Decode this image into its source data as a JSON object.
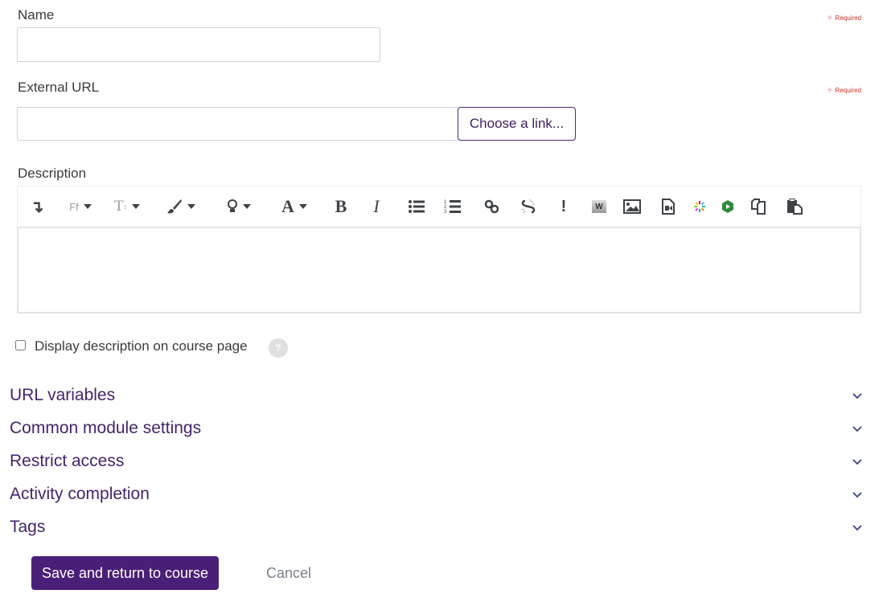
{
  "fields": {
    "name": {
      "label": "Name",
      "value": "",
      "required_text": "Required"
    },
    "external_url": {
      "label": "External URL",
      "value": "",
      "required_text": "Required",
      "choose_link_label": "Choose a link..."
    },
    "description": {
      "label": "Description",
      "value": "",
      "toolbar": [
        {
          "name": "collapse-toolbar-icon",
          "glyph": "↴"
        },
        {
          "name": "font-family-icon",
          "glyph": "Ff",
          "dropdown": true
        },
        {
          "name": "font-size-icon",
          "glyph": "T",
          "dropdown": true
        },
        {
          "name": "paint-brush-icon",
          "glyph": "🖌",
          "dropdown": true
        },
        {
          "name": "lightbulb-icon",
          "glyph": "💡",
          "dropdown": true
        },
        {
          "name": "font-color-icon",
          "glyph": "A",
          "dropdown": true
        },
        {
          "name": "bold-icon",
          "glyph": "B"
        },
        {
          "name": "italic-icon",
          "glyph": "I"
        },
        {
          "name": "bullet-list-icon",
          "glyph": "•"
        },
        {
          "name": "numbered-list-icon",
          "glyph": "1"
        },
        {
          "name": "link-icon",
          "glyph": "link"
        },
        {
          "name": "unlink-icon",
          "glyph": "unlink"
        },
        {
          "name": "accessibility-checker-icon",
          "glyph": "!"
        },
        {
          "name": "word-paste-icon",
          "glyph": "W"
        },
        {
          "name": "image-icon",
          "glyph": "image"
        },
        {
          "name": "media-icon",
          "glyph": "media"
        },
        {
          "name": "kaltura-icon",
          "glyph": "*"
        },
        {
          "name": "h5p-icon",
          "glyph": "h5p"
        },
        {
          "name": "copy-icon",
          "glyph": "copy"
        },
        {
          "name": "paste-icon",
          "glyph": "paste"
        }
      ]
    }
  },
  "display_description": {
    "label": "Display description on course page",
    "checked": false,
    "help_glyph": "?"
  },
  "sections": [
    {
      "label": "URL variables"
    },
    {
      "label": "Common module settings"
    },
    {
      "label": "Restrict access"
    },
    {
      "label": "Activity completion"
    },
    {
      "label": "Tags"
    }
  ],
  "actions": {
    "save_label": "Save and return to course",
    "cancel_label": "Cancel"
  },
  "colors": {
    "primary": "#4a1f78",
    "section_text": "#43246b",
    "required": "#ca3120"
  }
}
